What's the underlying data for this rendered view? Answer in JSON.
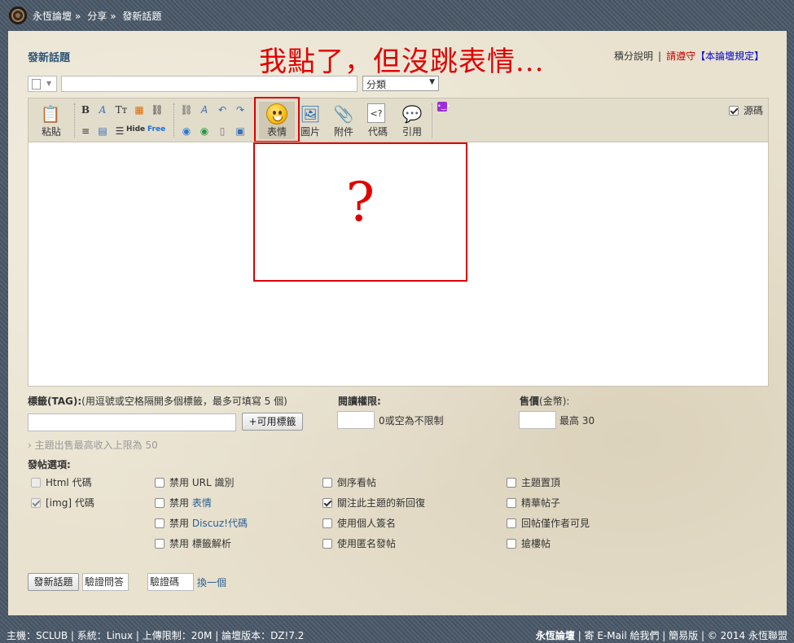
{
  "breadcrumb": {
    "site": "永恆論壇",
    "sep": "»",
    "forum": "分享",
    "page": "發新話題"
  },
  "page_title": "發新話題",
  "annotation": "我點了，但沒跳表情...",
  "question_mark": "?",
  "top_links": {
    "points_help": "積分說明",
    "sep": "|",
    "please_follow": "請遵守",
    "rules": "【本論壇規定】"
  },
  "subject": {
    "value": "",
    "category_placeholder": "分類"
  },
  "toolbar": {
    "paste": "粘貼",
    "bold": "B",
    "font_size": "Tт",
    "hide": "Hide",
    "free": "Free",
    "smilies": "表情",
    "image": "圖片",
    "attach": "附件",
    "code": "代碼",
    "quote": "引用",
    "source": "源碼"
  },
  "tags": {
    "label": "標籤(TAG):",
    "hint": "(用逗號或空格隔開多個標籤，最多可填寫 5 個)",
    "button": "+可用標籤"
  },
  "read_perm": {
    "label": "閱讀權限:",
    "hint": "0或空為不限制"
  },
  "price": {
    "label": "售價",
    "unit": "(金幣):",
    "max": "最高 30"
  },
  "sell_note": "主題出售最高收入上限為 50",
  "post_options_label": "發帖選項:",
  "options": {
    "col1": [
      {
        "label": "Html 代碼",
        "checked": false,
        "disabled": true
      },
      {
        "label": "[img] 代碼",
        "checked": true,
        "disabled": true
      }
    ],
    "col2": [
      {
        "prefix": "禁用",
        "label": "URL 識別",
        "checked": false
      },
      {
        "prefix": "禁用",
        "label": "表情",
        "checked": false
      },
      {
        "prefix": "禁用",
        "label": "Discuz!代碼",
        "checked": false
      },
      {
        "prefix": "禁用",
        "label": "標籤解析",
        "checked": false
      }
    ],
    "col3": [
      {
        "label": "倒序看帖",
        "checked": false
      },
      {
        "label": "關注此主題的新回復",
        "checked": true
      },
      {
        "label": "使用個人簽名",
        "checked": false
      },
      {
        "label": "使用匿名發帖",
        "checked": false
      }
    ],
    "col4": [
      {
        "label": "主題置頂",
        "checked": false
      },
      {
        "label": "精華帖子",
        "checked": false
      },
      {
        "label": "回帖僅作者可見",
        "checked": false
      },
      {
        "label": "搶樓帖",
        "checked": false
      }
    ]
  },
  "submit": {
    "post_button": "發新話題",
    "verify_q": "驗證問答",
    "captcha": "驗證碼",
    "refresh": "換一個"
  },
  "footer": {
    "left": "主機：SCLUB | 系統：Linux | 上傳限制：20M | 論壇版本：DZ!7.2",
    "site": "永恆論壇",
    "right": "| 寄 E-Mail 給我們 | 簡易版 | © 2014 永恆聯盟"
  }
}
